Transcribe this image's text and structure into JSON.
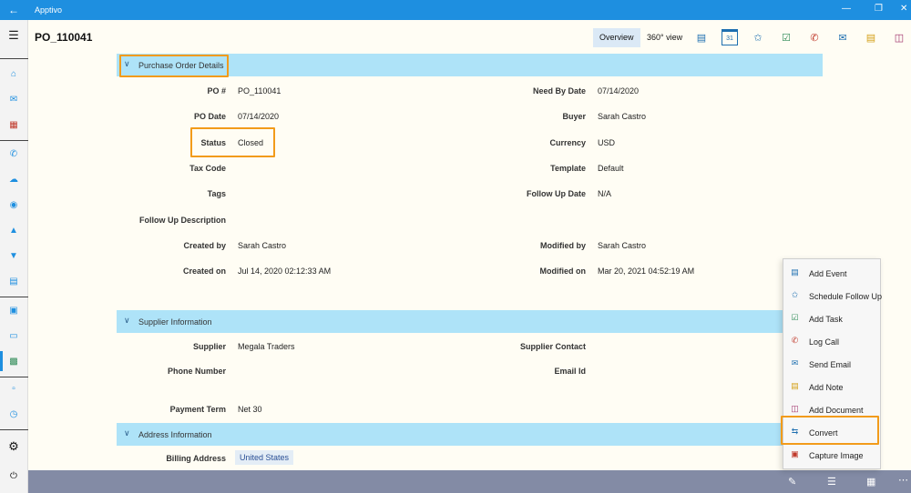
{
  "app": {
    "title": "Apptivo"
  },
  "header": {
    "title": "PO_110041",
    "overview": "Overview",
    "view360": "360° view",
    "tools": [
      "list-icon",
      "calendar-icon",
      "pin-icon",
      "task-icon",
      "call-icon",
      "email-icon",
      "note-icon",
      "document-icon"
    ],
    "calendar_day": "31"
  },
  "sections": {
    "po": "Purchase Order Details",
    "supplier": "Supplier Information",
    "address": "Address Information"
  },
  "po": {
    "po_num_label": "PO #",
    "po_num": "PO_110041",
    "po_date_label": "PO Date",
    "po_date": "07/14/2020",
    "status_label": "Status",
    "status": "Closed",
    "tax_code_label": "Tax Code",
    "tags_label": "Tags",
    "follow_desc_label": "Follow Up Description",
    "created_by_label": "Created by",
    "created_by": "Sarah Castro",
    "created_on_label": "Created on",
    "created_on": "Jul 14, 2020 02:12:33 AM",
    "need_by_label": "Need By Date",
    "need_by": "07/14/2020",
    "buyer_label": "Buyer",
    "buyer": "Sarah Castro",
    "currency_label": "Currency",
    "currency": "USD",
    "template_label": "Template",
    "template": "Default",
    "follow_date_label": "Follow Up Date",
    "follow_date": "N/A",
    "modified_by_label": "Modified by",
    "modified_by": "Sarah Castro",
    "modified_on_label": "Modified on",
    "modified_on": "Mar 20, 2021 04:52:19 AM"
  },
  "supplier": {
    "supplier_label": "Supplier",
    "supplier": "Megala Traders",
    "phone_label": "Phone Number",
    "payment_label": "Payment Term",
    "payment": "Net 30",
    "contact_label": "Supplier Contact",
    "email_label": "Email Id"
  },
  "address": {
    "billing_label": "Billing Address",
    "billing": "United States"
  },
  "menu": {
    "items": [
      {
        "label": "Add Event",
        "icon": "calendar-icon"
      },
      {
        "label": "Schedule Follow Up",
        "icon": "pin-icon"
      },
      {
        "label": "Add Task",
        "icon": "task-icon"
      },
      {
        "label": "Log Call",
        "icon": "call-icon"
      },
      {
        "label": "Send Email",
        "icon": "email-icon"
      },
      {
        "label": "Add Note",
        "icon": "note-icon"
      },
      {
        "label": "Add Document",
        "icon": "document-icon"
      },
      {
        "label": "Convert",
        "icon": "convert-icon"
      },
      {
        "label": "Capture Image",
        "icon": "camera-icon"
      }
    ]
  },
  "colors": {
    "accent": "#1e8fe0",
    "section": "#aee3f8",
    "highlight": "#f29b1a",
    "bottombar": "#838ba5"
  }
}
